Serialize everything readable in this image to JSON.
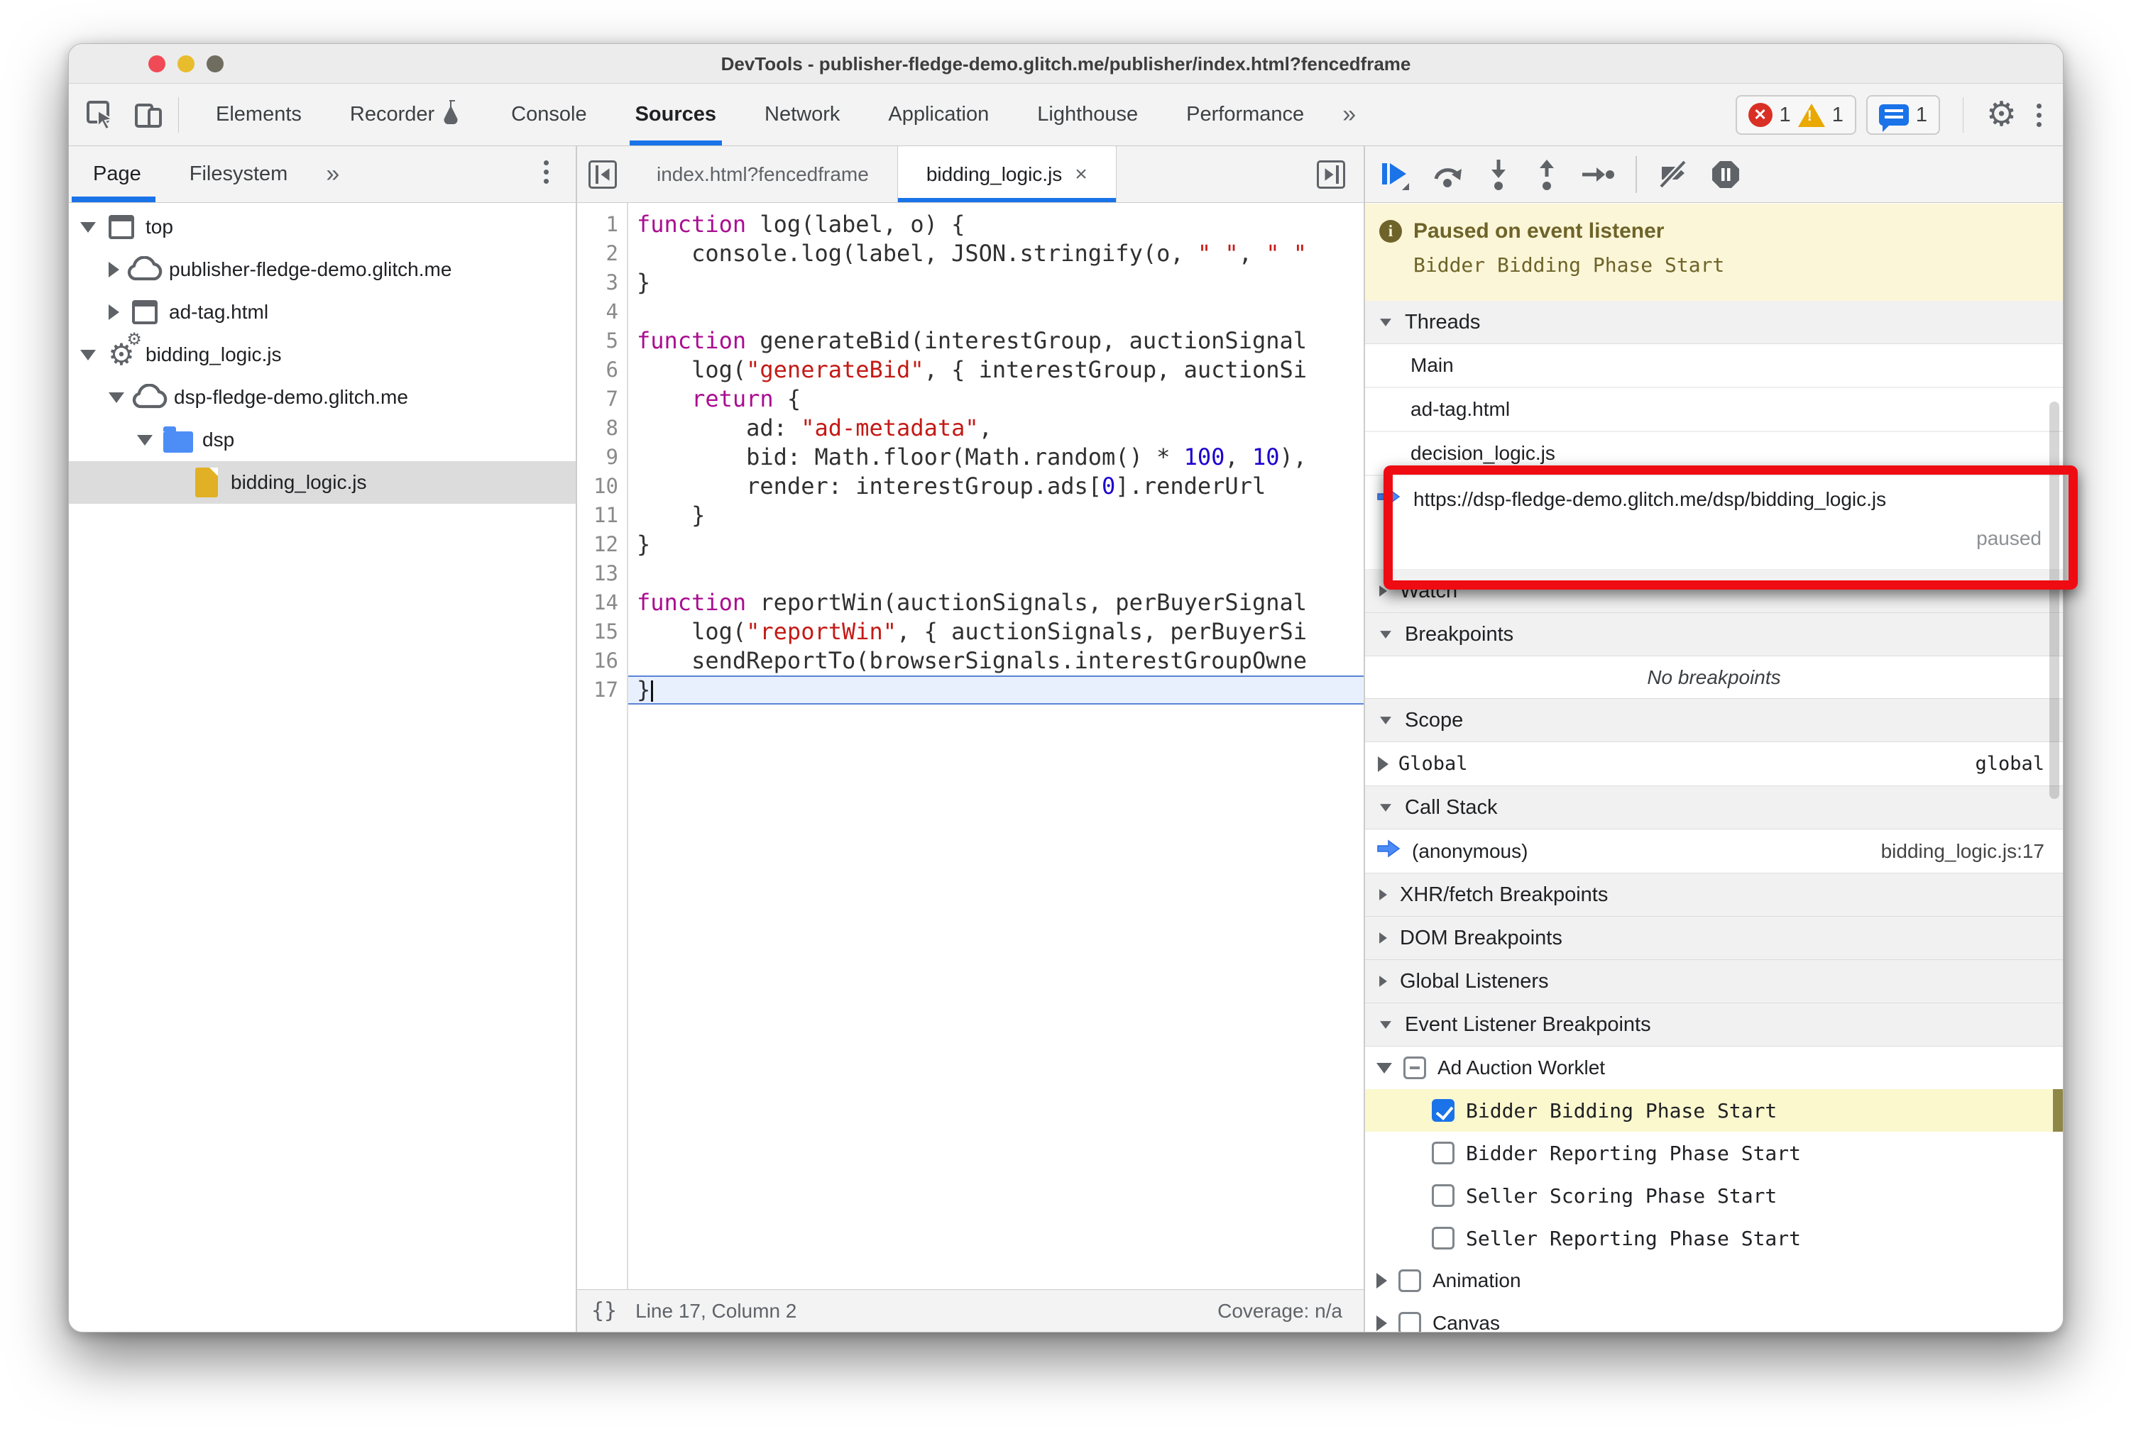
{
  "window": {
    "title": "DevTools - publisher-fledge-demo.glitch.me/publisher/index.html?fencedframe"
  },
  "toolbar": {
    "tabs": [
      {
        "label": "Elements",
        "active": false
      },
      {
        "label": "Recorder",
        "active": false,
        "icon": "flask-icon"
      },
      {
        "label": "Console",
        "active": false
      },
      {
        "label": "Sources",
        "active": true
      },
      {
        "label": "Network",
        "active": false
      },
      {
        "label": "Application",
        "active": false
      },
      {
        "label": "Lighthouse",
        "active": false
      },
      {
        "label": "Performance",
        "active": false
      }
    ],
    "more_tabs_label": "»",
    "error_count": "1",
    "warning_count": "1",
    "issues_count": "1"
  },
  "navigator": {
    "tabs": [
      {
        "label": "Page",
        "active": true
      },
      {
        "label": "Filesystem",
        "active": false
      }
    ],
    "more_label": "»",
    "tree": [
      {
        "depth": 0,
        "arrow": "down",
        "icon": "frame",
        "label": "top",
        "selected": false
      },
      {
        "depth": 1,
        "arrow": "right",
        "icon": "cloud",
        "label": "publisher-fledge-demo.glitch.me",
        "selected": false
      },
      {
        "depth": 1,
        "arrow": "right",
        "icon": "frame",
        "label": "ad-tag.html",
        "selected": false
      },
      {
        "depth": 0,
        "arrow": "down",
        "icon": "worker",
        "label": "bidding_logic.js",
        "selected": false
      },
      {
        "depth": 1,
        "arrow": "down",
        "icon": "cloud",
        "label": "dsp-fledge-demo.glitch.me",
        "selected": false
      },
      {
        "depth": 2,
        "arrow": "down",
        "icon": "folder",
        "label": "dsp",
        "selected": false
      },
      {
        "depth": 3,
        "arrow": "none",
        "icon": "file",
        "label": "bidding_logic.js",
        "selected": true
      }
    ]
  },
  "editor": {
    "tabs": [
      {
        "label": "index.html?fencedframe",
        "active": false,
        "closable": false
      },
      {
        "label": "bidding_logic.js",
        "active": true,
        "closable": true
      }
    ],
    "close_label": "×",
    "current_line": 17,
    "code": [
      [
        [
          "k",
          "function"
        ],
        [
          "p",
          " log(label, o) {"
        ]
      ],
      [
        [
          "p",
          "    console.log(label, JSON.stringify(o, "
        ],
        [
          "s",
          "\" \""
        ],
        [
          "p",
          ", "
        ],
        [
          "s",
          "\" \""
        ]
      ],
      [
        [
          "p",
          "}"
        ]
      ],
      [],
      [
        [
          "k",
          "function"
        ],
        [
          "p",
          " generateBid(interestGroup, auctionSignal"
        ]
      ],
      [
        [
          "p",
          "    log("
        ],
        [
          "s",
          "\"generateBid\""
        ],
        [
          "p",
          ", { interestGroup, auctionSi"
        ]
      ],
      [
        [
          "p",
          "    "
        ],
        [
          "k",
          "return"
        ],
        [
          "p",
          " {"
        ]
      ],
      [
        [
          "p",
          "        ad: "
        ],
        [
          "s",
          "\"ad-metadata\""
        ],
        [
          "p",
          ","
        ]
      ],
      [
        [
          "p",
          "        bid: Math.floor(Math.random() * "
        ],
        [
          "n",
          "100"
        ],
        [
          "p",
          ", "
        ],
        [
          "n",
          "10"
        ],
        [
          "p",
          "),"
        ]
      ],
      [
        [
          "p",
          "        render: interestGroup.ads["
        ],
        [
          "n",
          "0"
        ],
        [
          "p",
          "].renderUrl"
        ]
      ],
      [
        [
          "p",
          "    }"
        ]
      ],
      [
        [
          "p",
          "}"
        ]
      ],
      [],
      [
        [
          "k",
          "function"
        ],
        [
          "p",
          " reportWin(auctionSignals, perBuyerSignal"
        ]
      ],
      [
        [
          "p",
          "    log("
        ],
        [
          "s",
          "\"reportWin\""
        ],
        [
          "p",
          ", { auctionSignals, perBuyerSi"
        ]
      ],
      [
        [
          "p",
          "    sendReportTo(browserSignals.interestGroupOwne"
        ]
      ],
      [
        [
          "p",
          "}"
        ]
      ]
    ],
    "status": {
      "braces": "{}",
      "position": "Line 17, Column 2",
      "coverage": "Coverage: n/a"
    }
  },
  "debugger": {
    "banner": {
      "title": "Paused on event listener",
      "detail": "Bidder Bidding Phase Start"
    },
    "threads": {
      "label": "Threads",
      "items": [
        "Main",
        "ad-tag.html",
        "decision_logic.js"
      ],
      "current": {
        "url": "https://dsp-fledge-demo.glitch.me/dsp/bidding_logic.js",
        "status": "paused"
      }
    },
    "watch_label": "Watch",
    "breakpoints": {
      "label": "Breakpoints",
      "empty": "No breakpoints"
    },
    "scope": {
      "label": "Scope",
      "rows": [
        {
          "name": "Global",
          "value": "global"
        }
      ]
    },
    "call_stack": {
      "label": "Call Stack",
      "rows": [
        {
          "name": "(anonymous)",
          "location": "bidding_logic.js:17"
        }
      ]
    },
    "xhr_label": "XHR/fetch Breakpoints",
    "dom_label": "DOM Breakpoints",
    "global_listeners_label": "Global Listeners",
    "event_listener_label": "Event Listener Breakpoints",
    "event_tree": {
      "group": {
        "label": "Ad Auction Worklet",
        "checkbox": "indeterminate",
        "expanded": true
      },
      "children": [
        {
          "label": "Bidder Bidding Phase Start",
          "checked": true,
          "highlighted": true
        },
        {
          "label": "Bidder Reporting Phase Start",
          "checked": false,
          "highlighted": false
        },
        {
          "label": "Seller Scoring Phase Start",
          "checked": false,
          "highlighted": false
        },
        {
          "label": "Seller Reporting Phase Start",
          "checked": false,
          "highlighted": false
        }
      ],
      "siblings": [
        {
          "label": "Animation"
        },
        {
          "label": "Canvas"
        }
      ]
    }
  },
  "annotation": {
    "highlight_color": "#ef0b12"
  },
  "colors": {
    "accent": "#1a73e8",
    "paused_banner_bg": "#fcf6d8",
    "paused_banner_text": "#6e6329",
    "selected_row_bg": "#dcdcdc",
    "highlight_row_bg": "#fbf8ce",
    "keyword": "#aa0d91",
    "string": "#c41a16",
    "number": "#1c00cf"
  }
}
